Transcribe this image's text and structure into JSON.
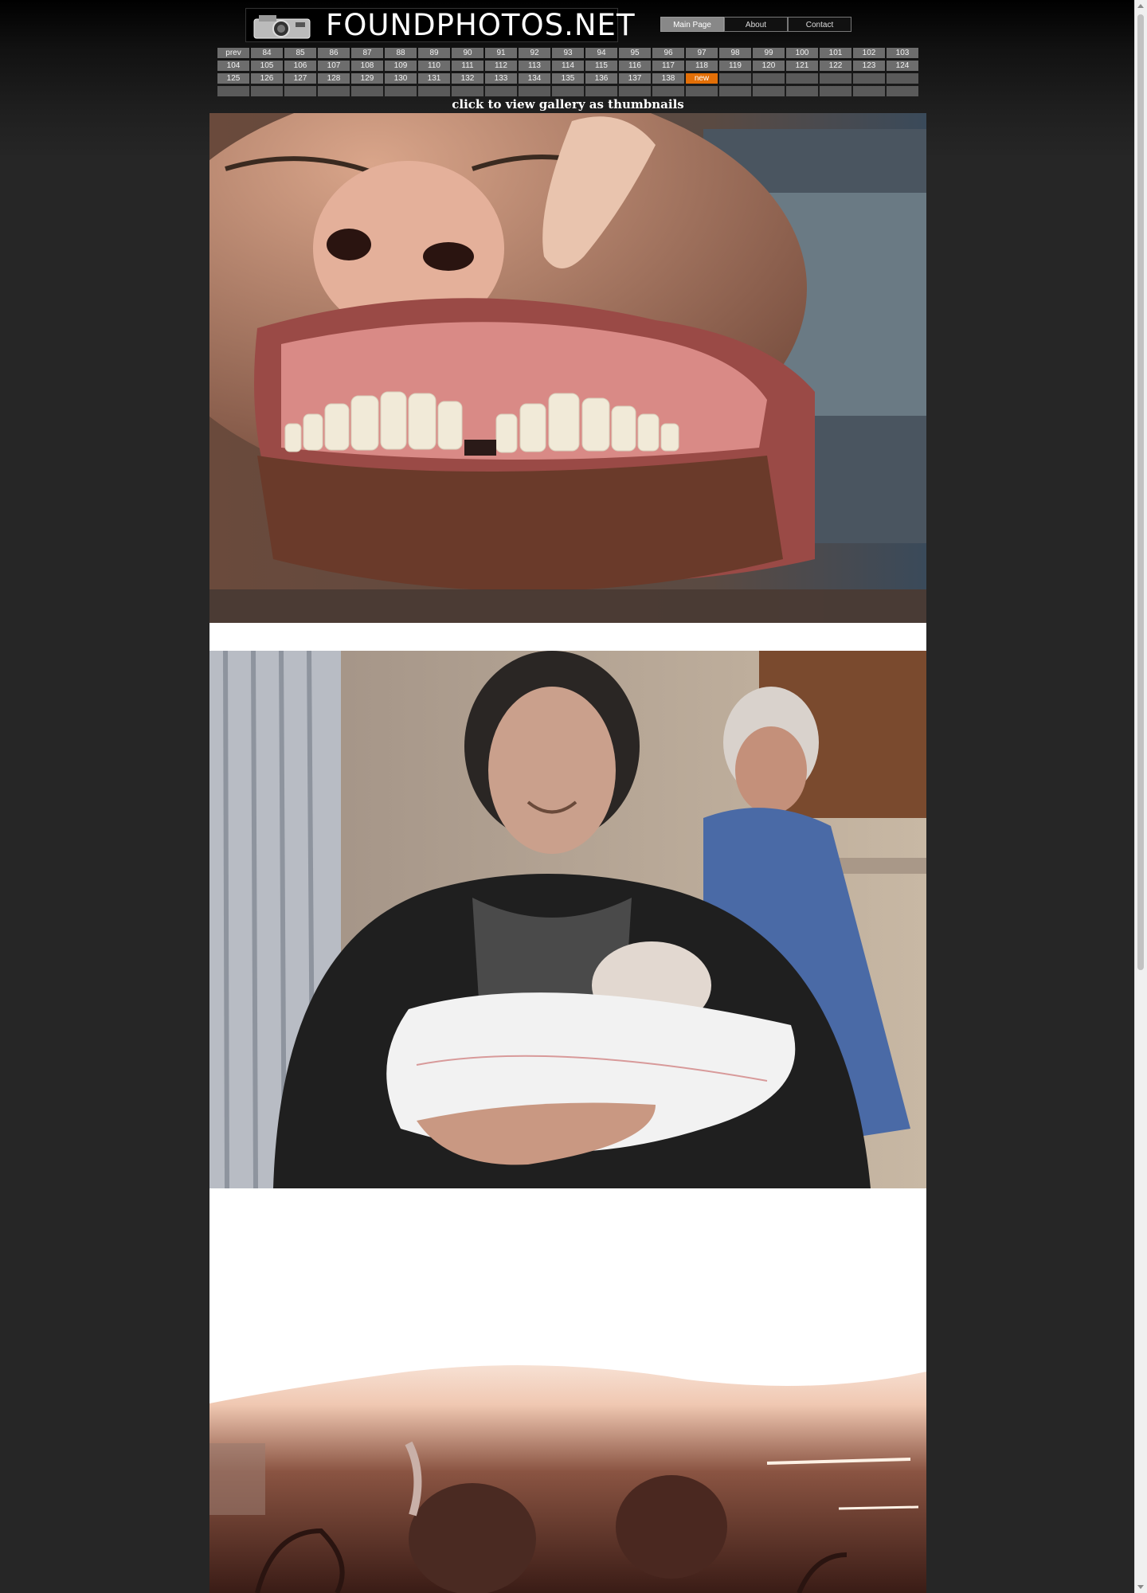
{
  "site": {
    "logo_text": "FOUNDPHOTOS.NET"
  },
  "topnav": [
    {
      "label": "Main Page",
      "active": true
    },
    {
      "label": "About",
      "active": false
    },
    {
      "label": "Contact",
      "active": false
    }
  ],
  "pager": {
    "rows": [
      [
        "prev",
        "84",
        "85",
        "86",
        "87",
        "88",
        "89",
        "90",
        "91",
        "92",
        "93",
        "94",
        "95",
        "96",
        "97",
        "98",
        "99",
        "100",
        "101",
        "102",
        "103"
      ],
      [
        "104",
        "105",
        "106",
        "107",
        "108",
        "109",
        "110",
        "111",
        "112",
        "113",
        "114",
        "115",
        "116",
        "117",
        "118",
        "119",
        "120",
        "121",
        "122",
        "123",
        "124"
      ],
      [
        "125",
        "126",
        "127",
        "128",
        "129",
        "130",
        "131",
        "132",
        "133",
        "134",
        "135",
        "136",
        "137",
        "138",
        "new",
        "",
        "",
        "",
        "",
        "",
        ""
      ],
      [
        "",
        "",
        "",
        "",
        "",
        "",
        "",
        "",
        "",
        "",
        "",
        "",
        "",
        "",
        "",
        "",
        "",
        "",
        "",
        "",
        ""
      ]
    ],
    "highlight": "new",
    "highlight_color": "#e36f07"
  },
  "gallery": {
    "thumbnails_link": "click to view gallery as thumbnails",
    "photos": [
      {
        "name": "photo-open-mouth-teeth"
      },
      {
        "name": "photo-man-holding-newborn"
      },
      {
        "name": "photo-overexposed-room"
      }
    ]
  }
}
